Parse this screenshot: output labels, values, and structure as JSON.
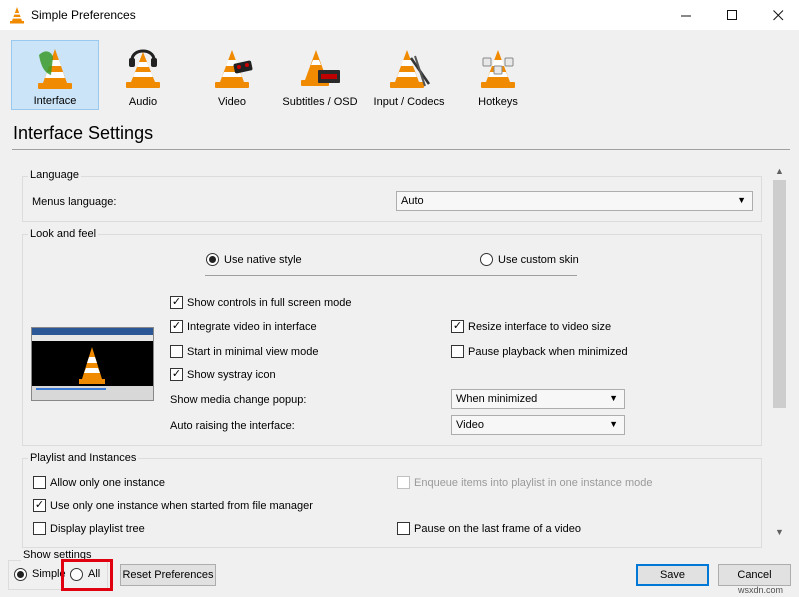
{
  "window": {
    "title": "Simple Preferences",
    "controls": [
      "minimize-icon",
      "maximize-icon",
      "close-icon"
    ]
  },
  "categories": [
    {
      "label": "Interface",
      "icon": "interface-cone-icon",
      "selected": true
    },
    {
      "label": "Audio",
      "icon": "audio-cone-headphones-icon",
      "selected": false
    },
    {
      "label": "Video",
      "icon": "video-cone-glasses-icon",
      "selected": false
    },
    {
      "label": "Subtitles / OSD",
      "icon": "subtitles-cone-icon",
      "selected": false
    },
    {
      "label": "Input / Codecs",
      "icon": "input-codecs-cone-icon",
      "selected": false
    },
    {
      "label": "Hotkeys",
      "icon": "hotkeys-cone-icon",
      "selected": false
    }
  ],
  "page_title": "Interface Settings",
  "language": {
    "group_title": "Language",
    "menus_language_label": "Menus language:",
    "menus_language_value": "Auto"
  },
  "look_and_feel": {
    "group_title": "Look and feel",
    "native_style_label": "Use native style",
    "native_style_checked": true,
    "custom_skin_label": "Use custom skin",
    "custom_skin_checked": false,
    "fullscreen_controls_label": "Show controls in full screen mode",
    "fullscreen_controls_checked": true,
    "integrate_video_label": "Integrate video in interface",
    "integrate_video_checked": true,
    "resize_interface_label": "Resize interface to video size",
    "resize_interface_checked": true,
    "minimal_view_label": "Start in minimal view mode",
    "minimal_view_checked": false,
    "pause_minimized_label": "Pause playback when minimized",
    "pause_minimized_checked": false,
    "systray_label": "Show systray icon",
    "systray_checked": true,
    "media_popup_label": "Show media change popup:",
    "media_popup_value": "When minimized",
    "auto_raise_label": "Auto raising the interface:",
    "auto_raise_value": "Video"
  },
  "playlist": {
    "group_title": "Playlist and Instances",
    "one_instance_label": "Allow only one instance",
    "one_instance_checked": false,
    "enqueue_label": "Enqueue items into playlist in one instance mode",
    "enqueue_checked": false,
    "file_manager_label": "Use only one instance when started from file manager",
    "file_manager_checked": true,
    "pause_last_frame_label": "Pause on the last frame of a video",
    "pause_last_frame_checked": false,
    "playlist_tree_label": "Display playlist tree",
    "playlist_tree_checked": false
  },
  "show_settings": {
    "title": "Show settings",
    "simple_label": "Simple",
    "simple_checked": true,
    "all_label": "All",
    "all_checked": false
  },
  "buttons": {
    "reset": "Reset Preferences",
    "save": "Save",
    "cancel": "Cancel"
  },
  "watermark": "wsxdn.com",
  "colors": {
    "selected_category_bg": "#cce4f7",
    "highlight_box": "#e0000f",
    "default_button_border": "#0078d7",
    "vlc_orange": "#f08a00"
  }
}
